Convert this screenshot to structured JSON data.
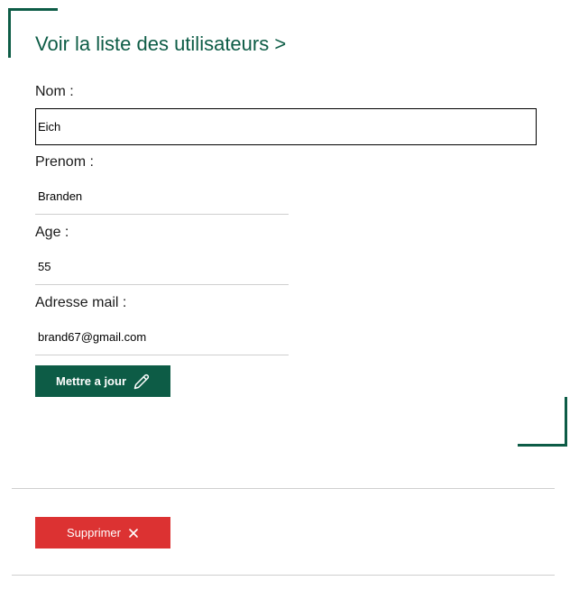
{
  "header": {
    "title_link": "Voir la liste des utilisateurs >"
  },
  "form": {
    "nom": {
      "label": "Nom :",
      "value": "Eich"
    },
    "prenom": {
      "label": "Prenom :",
      "value": "Branden"
    },
    "age": {
      "label": "Age :",
      "value": "55"
    },
    "email": {
      "label": "Adresse mail :",
      "value": "brand67@gmail.com"
    }
  },
  "actions": {
    "update_label": "Mettre a jour",
    "update_icon": "pencil-icon",
    "delete_label": "Supprimer",
    "delete_icon": "close-icon"
  },
  "colors": {
    "accent": "#0d5c46",
    "danger": "#dc3232",
    "divider": "#cfcfcf"
  }
}
